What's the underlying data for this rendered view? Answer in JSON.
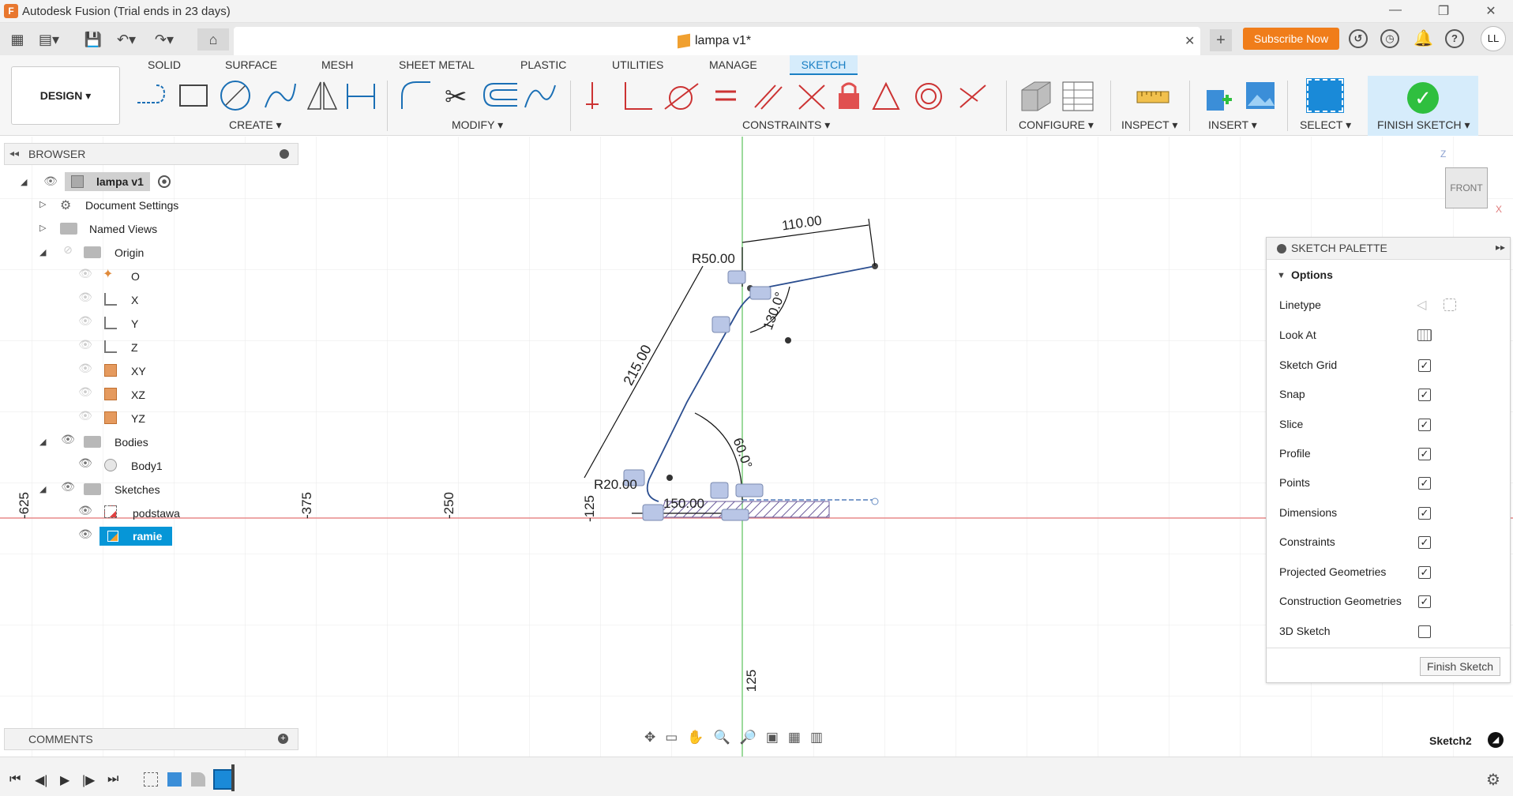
{
  "app": {
    "title": "Autodesk Fusion (Trial ends in 23 days)",
    "logo": "F"
  },
  "window": {
    "minimize": "—",
    "restore": "❐",
    "close": "✕"
  },
  "tabbar": {
    "doc_title": "lampa v1*",
    "close": "✕",
    "add": "+",
    "subscribe": "Subscribe Now",
    "avatar": "LL"
  },
  "ribbon": {
    "workspace": "DESIGN ▾",
    "tabs": [
      "SOLID",
      "SURFACE",
      "MESH",
      "SHEET METAL",
      "PLASTIC",
      "UTILITIES",
      "MANAGE",
      "SKETCH"
    ],
    "groups": {
      "create": "CREATE ▾",
      "modify": "MODIFY ▾",
      "constraints": "CONSTRAINTS ▾",
      "configure": "CONFIGURE ▾",
      "inspect": "INSPECT ▾",
      "insert": "INSERT ▾",
      "select": "SELECT ▾",
      "finish": "FINISH SKETCH ▾"
    }
  },
  "browser": {
    "title": "BROWSER",
    "items": {
      "root": "lampa v1",
      "doc_settings": "Document Settings",
      "named_views": "Named Views",
      "origin": "Origin",
      "o": "O",
      "x": "X",
      "y": "Y",
      "z": "Z",
      "xy": "XY",
      "xz": "XZ",
      "yz": "YZ",
      "bodies": "Bodies",
      "body1": "Body1",
      "sketches": "Sketches",
      "podstawa": "podstawa",
      "ramie": "ramie"
    }
  },
  "comments": {
    "title": "COMMENTS"
  },
  "viewcube": {
    "face": "FRONT",
    "z": "Z",
    "x": "X"
  },
  "canvas": {
    "dims": {
      "d110": "110.00",
      "r50": "R50.00",
      "d130": "130.0°",
      "d215": "215.00",
      "d60": "60.0°",
      "r20": "R20.00",
      "d150": "150.00"
    },
    "ruler": {
      "m625": "-625",
      "m375": "-375",
      "m250": "-250",
      "m125": "-125",
      "p125": "125"
    }
  },
  "palette": {
    "title": "SKETCH PALETTE",
    "section": "Options",
    "rows": {
      "linetype": "Linetype",
      "lookat": "Look At",
      "grid": "Sketch Grid",
      "snap": "Snap",
      "slice": "Slice",
      "profile": "Profile",
      "points": "Points",
      "dimensions": "Dimensions",
      "constraints": "Constraints",
      "projected": "Projected Geometries",
      "construction": "Construction Geometries",
      "sketch3d": "3D Sketch"
    },
    "checked": {
      "grid": true,
      "snap": true,
      "slice": true,
      "profile": true,
      "points": true,
      "dimensions": true,
      "constraints": true,
      "projected": true,
      "construction": true,
      "sketch3d": false
    },
    "finish_button": "Finish Sketch"
  },
  "status": {
    "sketch_name": "Sketch2"
  },
  "colors": {
    "accent": "#0696d7",
    "subscribe": "#f07d1a",
    "finish": "#2fbf3f",
    "sketch_line": "#2a4d8f",
    "y_axis": "#7ccd7c",
    "x_axis": "#e88a8a"
  }
}
